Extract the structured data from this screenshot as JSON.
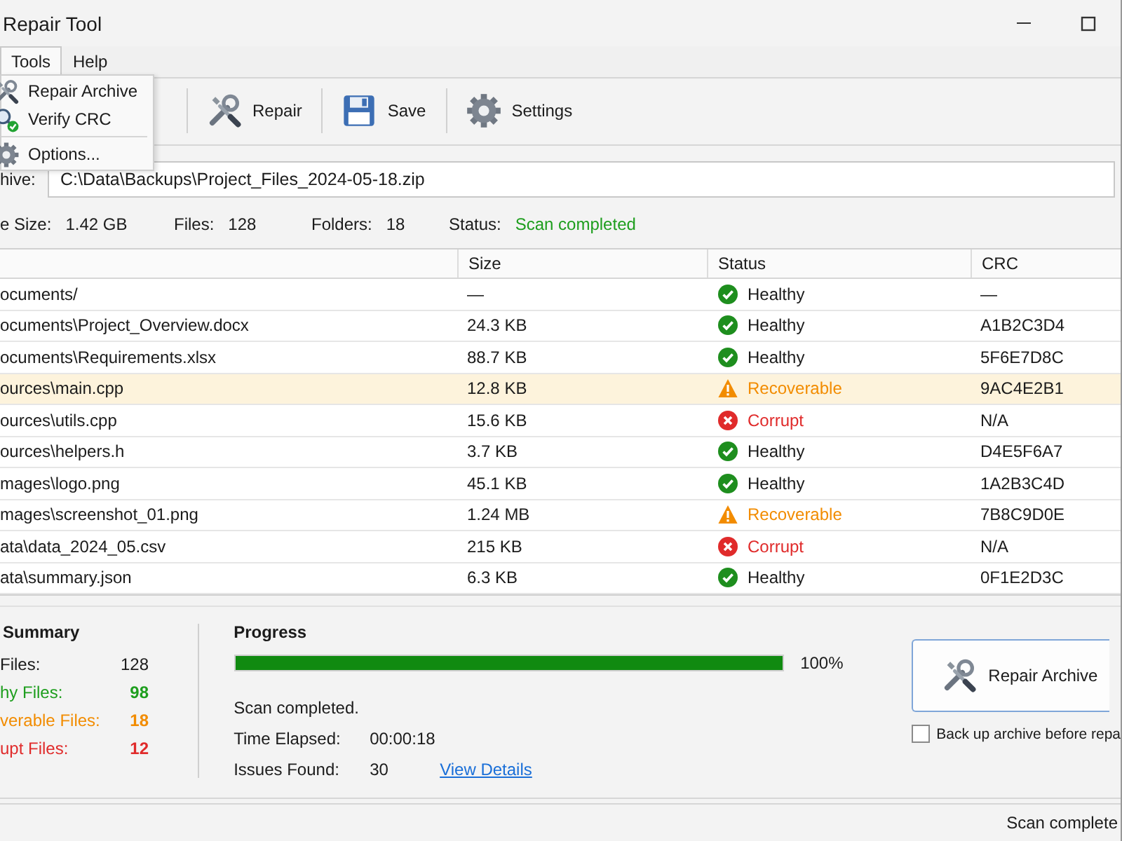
{
  "window": {
    "title": "Repair Tool"
  },
  "menu_bar": [
    {
      "label": "Tools",
      "selected": true
    },
    {
      "label": "Help",
      "selected": false
    }
  ],
  "tools_menu": [
    {
      "kind": "repair",
      "label": "Repair Archive"
    },
    {
      "kind": "verify",
      "label": "Verify CRC"
    },
    {
      "kind": "separator"
    },
    {
      "kind": "options",
      "label": "Options..."
    }
  ],
  "toolbar": [
    {
      "kind": "repair",
      "label": "Repair"
    },
    {
      "kind": "save",
      "label": "Save"
    },
    {
      "kind": "settings",
      "label": "Settings"
    }
  ],
  "archive": {
    "label": "hive:",
    "value": "C:\\Data\\Backups\\Project_Files_2024-05-18.zip"
  },
  "info": [
    {
      "label": "e Size:",
      "value": "1.42 GB",
      "kind": "plain"
    },
    {
      "label": "Files:",
      "value": "128",
      "kind": "plain"
    },
    {
      "label": "Folders:",
      "value": "18",
      "kind": "plain"
    },
    {
      "label": "Status:",
      "value": "Scan completed",
      "kind": "success"
    }
  ],
  "table": {
    "columns": [
      "Size",
      "Status",
      "CRC"
    ],
    "rows": [
      {
        "name": "ocuments/",
        "size": "—",
        "status": {
          "kind": "healthy",
          "label": "Healthy"
        },
        "crc": "—",
        "selected": false
      },
      {
        "name": "ocuments\\Project_Overview.docx",
        "size": "24.3 KB",
        "status": {
          "kind": "healthy",
          "label": "Healthy"
        },
        "crc": "A1B2C3D4",
        "selected": false
      },
      {
        "name": "ocuments\\Requirements.xlsx",
        "size": "88.7 KB",
        "status": {
          "kind": "healthy",
          "label": "Healthy"
        },
        "crc": "5F6E7D8C",
        "selected": false
      },
      {
        "name": "ources\\main.cpp",
        "size": "12.8 KB",
        "status": {
          "kind": "recoverable",
          "label": "Recoverable"
        },
        "crc": "9AC4E2B1",
        "selected": true
      },
      {
        "name": "ources\\utils.cpp",
        "size": "15.6 KB",
        "status": {
          "kind": "corrupt",
          "label": "Corrupt"
        },
        "crc": "N/A",
        "selected": false
      },
      {
        "name": "ources\\helpers.h",
        "size": "3.7 KB",
        "status": {
          "kind": "healthy",
          "label": "Healthy"
        },
        "crc": "D4E5F6A7",
        "selected": false
      },
      {
        "name": "mages\\logo.png",
        "size": "45.1 KB",
        "status": {
          "kind": "healthy",
          "label": "Healthy"
        },
        "crc": "1A2B3C4D",
        "selected": false
      },
      {
        "name": "mages\\screenshot_01.png",
        "size": "1.24 MB",
        "status": {
          "kind": "recoverable",
          "label": "Recoverable"
        },
        "crc": "7B8C9D0E",
        "selected": false
      },
      {
        "name": "ata\\data_2024_05.csv",
        "size": "215 KB",
        "status": {
          "kind": "corrupt",
          "label": "Corrupt"
        },
        "crc": "N/A",
        "selected": false
      },
      {
        "name": "ata\\summary.json",
        "size": "6.3 KB",
        "status": {
          "kind": "healthy",
          "label": "Healthy"
        },
        "crc": "0F1E2D3C",
        "selected": false
      }
    ]
  },
  "summary": {
    "title": "Summary",
    "rows": [
      {
        "kind": "total",
        "label": "Files:",
        "value": "128"
      },
      {
        "kind": "healthy",
        "label": "hy Files:",
        "value": "98"
      },
      {
        "kind": "recoverable",
        "label": "verable Files:",
        "value": "18"
      },
      {
        "kind": "corrupt",
        "label": "upt Files:",
        "value": "12"
      }
    ]
  },
  "progress": {
    "title": "Progress",
    "level": 1,
    "reading": "100%",
    "message": "Scan completed.",
    "details": [
      {
        "label": "Time Elapsed:",
        "value": "00:00:18"
      },
      {
        "label": "Issues Found:",
        "value": "30",
        "link": "View Details"
      }
    ]
  },
  "repair_button": {
    "label": "Repair Archive"
  },
  "backup_option": {
    "label": "Back up archive before repa",
    "checked": false
  },
  "status_bar": {
    "text": "Scan complete"
  }
}
